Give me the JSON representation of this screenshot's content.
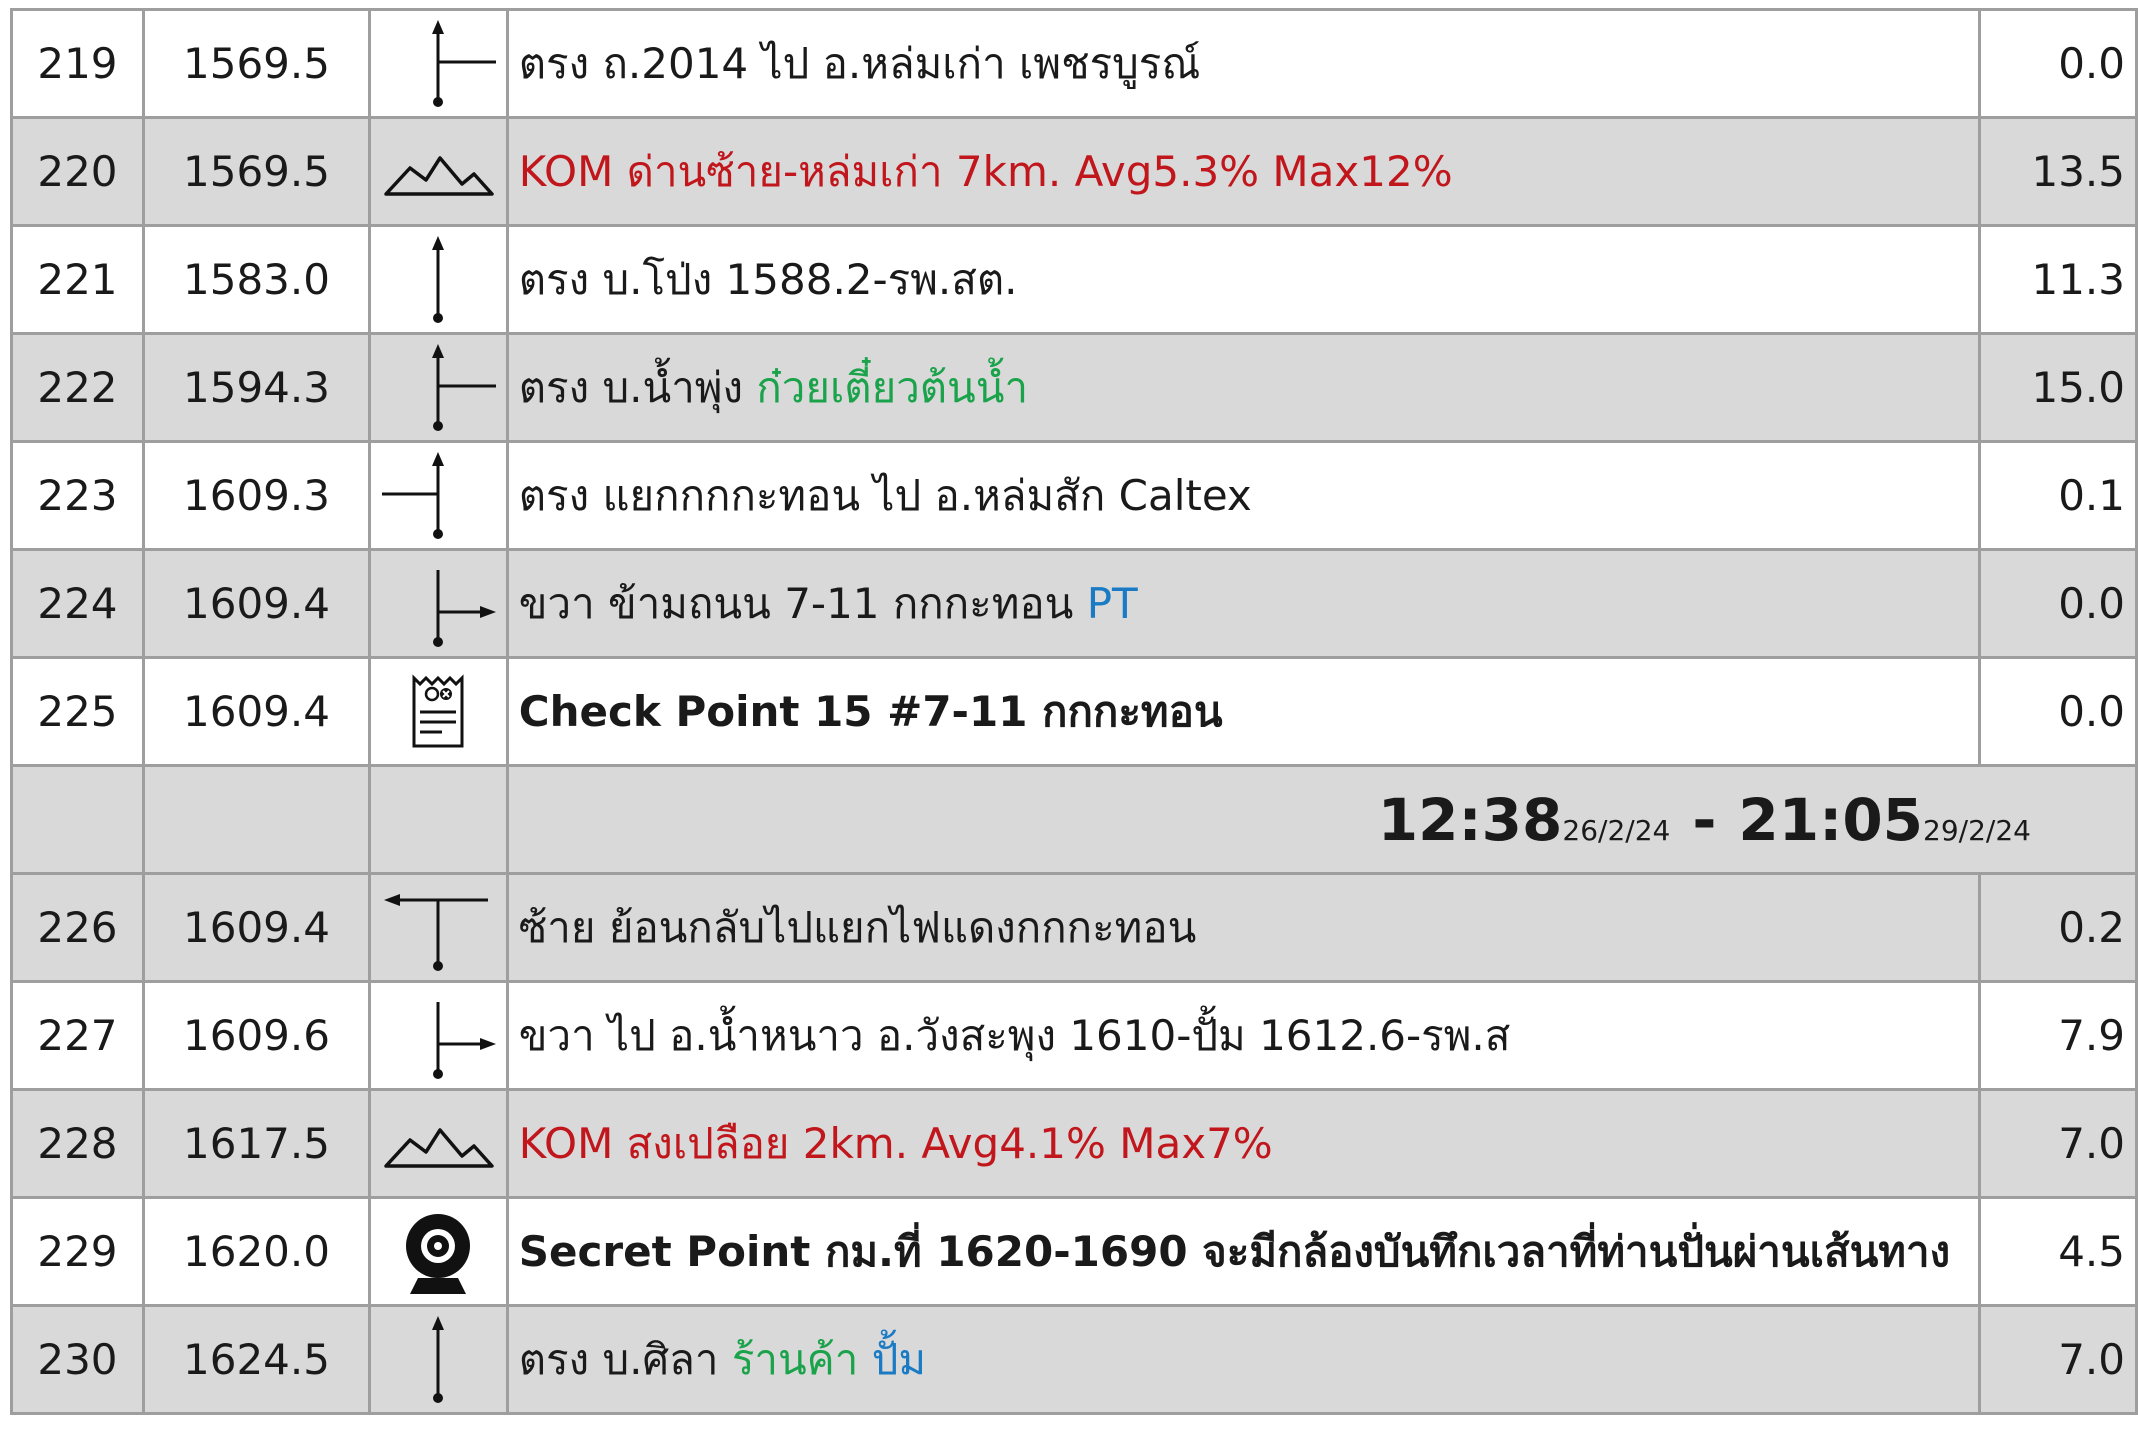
{
  "rows": [
    {
      "no": "219",
      "km": "1569.5",
      "icon": "straight-right-junction-icon",
      "desc": [
        {
          "t": "ตรง ถ.2014 ไป อ.หล่มเก่า เพชรบูรณ์",
          "c": ""
        }
      ],
      "dist": "0.0"
    },
    {
      "no": "220",
      "km": "1569.5",
      "icon": "mountain-icon",
      "desc": [
        {
          "t": "KOM ด่านซ้าย-หล่มเก่า 7km. Avg5.3% Max12%",
          "c": "red"
        }
      ],
      "dist": "13.5"
    },
    {
      "no": "221",
      "km": "1583.0",
      "icon": "straight-arrow-icon",
      "desc": [
        {
          "t": "ตรง บ.โป่ง 1588.2-รพ.สต.",
          "c": ""
        }
      ],
      "dist": "11.3"
    },
    {
      "no": "222",
      "km": "1594.3",
      "icon": "straight-right-junction-icon",
      "desc": [
        {
          "t": "ตรง บ.น้ำพุ่ง ",
          "c": ""
        },
        {
          "t": "ก๋วยเตี๋ยวต้นน้ำ",
          "c": "green"
        }
      ],
      "dist": "15.0"
    },
    {
      "no": "223",
      "km": "1609.3",
      "icon": "straight-left-junction-icon",
      "desc": [
        {
          "t": "ตรง แยกกกกะทอน ไป อ.หล่มสัก Caltex",
          "c": ""
        }
      ],
      "dist": "0.1"
    },
    {
      "no": "224",
      "km": "1609.4",
      "icon": "turn-right-arrow-icon",
      "desc": [
        {
          "t": "ขวา ข้ามถนน 7-11 กกกะทอน ",
          "c": ""
        },
        {
          "t": "PT",
          "c": "blue"
        }
      ],
      "dist": "0.0"
    },
    {
      "no": "225",
      "km": "1609.4",
      "icon": "checkpoint-receipt-icon",
      "desc": [
        {
          "t": "Check Point 15 #7-11 กกกะทอน",
          "c": "bold"
        }
      ],
      "dist": "0.0"
    },
    {
      "no": "226",
      "km": "1609.4",
      "icon": "turn-left-arrow-icon",
      "desc": [
        {
          "t": "ซ้าย ย้อนกลับไปแยกไฟแดงกกกะทอน",
          "c": ""
        }
      ],
      "dist": "0.2"
    },
    {
      "no": "227",
      "km": "1609.6",
      "icon": "turn-right-arrow-icon",
      "desc": [
        {
          "t": "ขวา ไป อ.น้ำหนาว อ.วังสะพุง 1610-ปั้ม 1612.6-รพ.ส",
          "c": ""
        }
      ],
      "dist": "7.9"
    },
    {
      "no": "228",
      "km": "1617.5",
      "icon": "mountain-icon",
      "desc": [
        {
          "t": "KOM สงเปลือย 2km. Avg4.1% Max7%",
          "c": "red"
        }
      ],
      "dist": "7.0"
    },
    {
      "no": "229",
      "km": "1620.0",
      "icon": "webcam-icon",
      "desc": [
        {
          "t": "Secret Point  กม.ที่ 1620-1690 จะมีกล้องบันทึกเวลาที่ท่านปั่นผ่านเส้นทาง",
          "c": "bold"
        }
      ],
      "dist": "4.5"
    },
    {
      "no": "230",
      "km": "1624.5",
      "icon": "straight-arrow-icon",
      "desc": [
        {
          "t": "ตรง บ.ศิลา ",
          "c": ""
        },
        {
          "t": "ร้านค้า",
          "c": "green"
        },
        {
          "t": " ",
          "c": ""
        },
        {
          "t": "ปั้ม",
          "c": "blue"
        }
      ],
      "dist": "7.0"
    }
  ],
  "checkpoint_time": {
    "open_time": "12:38",
    "open_date": "26/2/24",
    "separator": "-",
    "close_time": "21:05",
    "close_date": "29/2/24"
  },
  "colors": {
    "shade": "#d9d9d9",
    "grid": "#9e9e9e",
    "red": "#c0161c",
    "green": "#1aa34a",
    "blue": "#1a7bc4"
  }
}
